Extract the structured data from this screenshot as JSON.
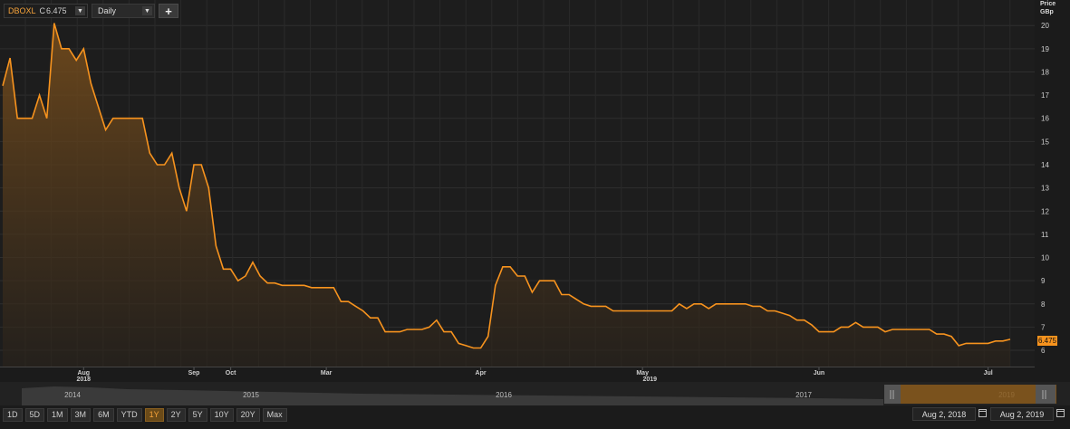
{
  "toolbar": {
    "symbol": "DBOXL",
    "close_prefix": "C",
    "close_value": "6.475",
    "interval": "Daily",
    "add_label": "+"
  },
  "axis": {
    "price_label_line1": "Price",
    "price_label_line2": "GBp",
    "last_price": "6.475"
  },
  "chart_data": {
    "type": "area",
    "series": [
      {
        "values": [
          17.4,
          18.6,
          16.0,
          16.0,
          16.0,
          17.0,
          16.0,
          20.1,
          19.0,
          19.0,
          18.5,
          19.0,
          17.5,
          16.5,
          15.5,
          16.0,
          16.0,
          16.0,
          16.0,
          16.0,
          14.5,
          14.0,
          14.0,
          14.5,
          13.0,
          12.0,
          14.0,
          14.0,
          13.0,
          10.5,
          9.5,
          9.5,
          9.0,
          9.2,
          9.8,
          9.2,
          8.9,
          8.9,
          8.8,
          8.8,
          8.8,
          8.8,
          8.7,
          8.7,
          8.7,
          8.7,
          8.1,
          8.1,
          7.9,
          7.7,
          7.4,
          7.4,
          6.8,
          6.8,
          6.8,
          6.9,
          6.9,
          6.9,
          7.0,
          7.3,
          6.8,
          6.8,
          6.3,
          6.2,
          6.1,
          6.1,
          6.6,
          8.8,
          9.6,
          9.6,
          9.2,
          9.2,
          8.5,
          9.0,
          9.0,
          9.0,
          8.4,
          8.4,
          8.2,
          8.0,
          7.9,
          7.9,
          7.9,
          7.7,
          7.7,
          7.7,
          7.7,
          7.7,
          7.7,
          7.7,
          7.7,
          7.7,
          8.0,
          7.8,
          8.0,
          8.0,
          7.8,
          8.0,
          8.0,
          8.0,
          8.0,
          8.0,
          7.9,
          7.9,
          7.7,
          7.7,
          7.6,
          7.5,
          7.3,
          7.3,
          7.1,
          6.8,
          6.8,
          6.8,
          7.0,
          7.0,
          7.2,
          7.0,
          7.0,
          7.0,
          6.8,
          6.9,
          6.9,
          6.9,
          6.9,
          6.9,
          6.9,
          6.7,
          6.7,
          6.6,
          6.2,
          6.3,
          6.3,
          6.3,
          6.3,
          6.4,
          6.4,
          6.475
        ]
      }
    ],
    "y_ticks": [
      6,
      7,
      8,
      9,
      10,
      11,
      12,
      13,
      14,
      15,
      16,
      17,
      18,
      19,
      20
    ],
    "ylim": [
      5.3,
      21.1
    ],
    "x_month_labels": [
      {
        "label": "Aug",
        "index": 11
      },
      {
        "label": "Sep",
        "index": 26
      },
      {
        "label": "Oct",
        "index": 31
      },
      {
        "label": "Mar",
        "index": 44
      },
      {
        "label": "Apr",
        "index": 65
      },
      {
        "label": "May",
        "index": 87
      },
      {
        "label": "Jun",
        "index": 111
      },
      {
        "label": "Jul",
        "index": 134
      }
    ],
    "x_year_labels": [
      {
        "label": "2018",
        "index": 11
      },
      {
        "label": "2019",
        "index": 88
      }
    ],
    "grid": true,
    "line_color": "#f7931e"
  },
  "navigator": {
    "years": [
      "2014",
      "2015",
      "2016",
      "2017",
      "2019"
    ]
  },
  "range_buttons": [
    "1D",
    "5D",
    "1M",
    "3M",
    "6M",
    "YTD",
    "1Y",
    "2Y",
    "5Y",
    "10Y",
    "20Y",
    "Max"
  ],
  "active_range": "1Y",
  "date_range": {
    "start": "Aug 2, 2018",
    "end": "Aug 2, 2019"
  }
}
